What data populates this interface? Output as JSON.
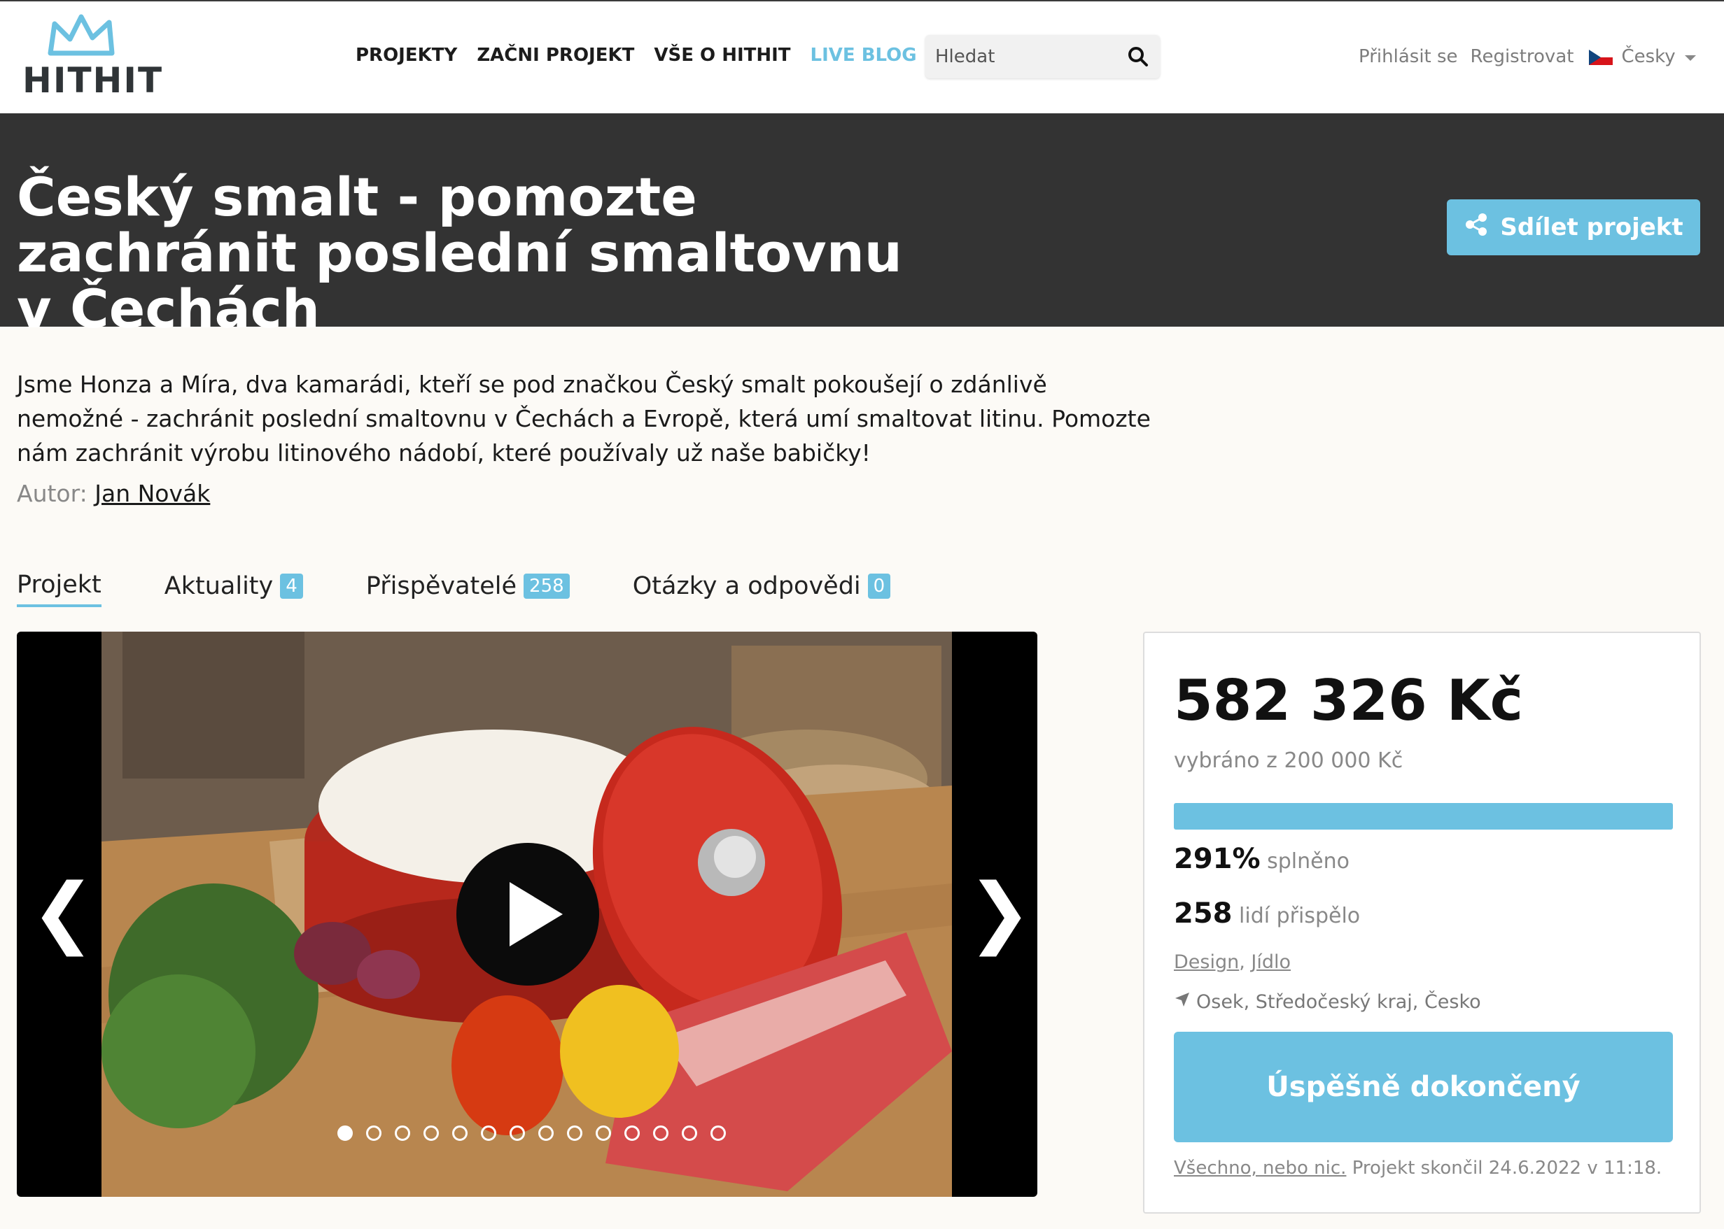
{
  "brand": {
    "logo_text": "HITHIT",
    "accent_color": "#6cc1e1",
    "dark_band_color": "#333333"
  },
  "nav": {
    "items": [
      "PROJEKTY",
      "ZAČNI PROJEKT",
      "VŠE O HITHIT",
      "LIVE BLOG"
    ]
  },
  "search": {
    "placeholder": "Hledat",
    "icon": "search-icon"
  },
  "auth": {
    "login": "Přihlásit se",
    "register": "Registrovat",
    "language": "Česky",
    "flag": "czech-flag-icon"
  },
  "project": {
    "title": "Český smalt - pomozte zachránit poslední smaltovnu v Čechách",
    "share_label": "Sdílet projekt",
    "description": "Jsme Honza a Míra, dva kamarádi, kteří se pod značkou Český smalt pokoušejí o zdánlivě nemožné - zachránit poslední smaltovnu v Čechách a Evropě, která umí smaltovat litinu. Pomozte nám zachránit výrobu litinového nádobí, které používaly už naše babičky!",
    "author_label": "Autor:",
    "author_name": "Jan Novák"
  },
  "tabs": [
    {
      "label": "Projekt",
      "badge": null,
      "active": true
    },
    {
      "label": "Aktuality",
      "badge": "4"
    },
    {
      "label": "Přispěvatelé",
      "badge": "258"
    },
    {
      "label": "Otázky a odpovědi",
      "badge": "0"
    }
  ],
  "gallery": {
    "prev": "❮",
    "next": "❯",
    "slide_count": 14,
    "active_slide": 1,
    "media_description": "Red enamel cast-iron pot with lid on wooden table with peppers, onions and parsley"
  },
  "stats": {
    "amount": "582 326 Kč",
    "goal_text": "vybráno z 200 000 Kč",
    "progress_fraction": 1.0,
    "percent": "291%",
    "percent_label": "splněno",
    "backers": "258",
    "backers_label": "lidí přispělo",
    "categories": [
      "Design",
      "Jídlo"
    ],
    "location": "Osek, Středočeský kraj, Česko",
    "status_button": "Úspěšně dokončený",
    "note_link": "Všechno, nebo nic.",
    "note_text": "Projekt skončil 24.6.2022 v 11:18."
  }
}
